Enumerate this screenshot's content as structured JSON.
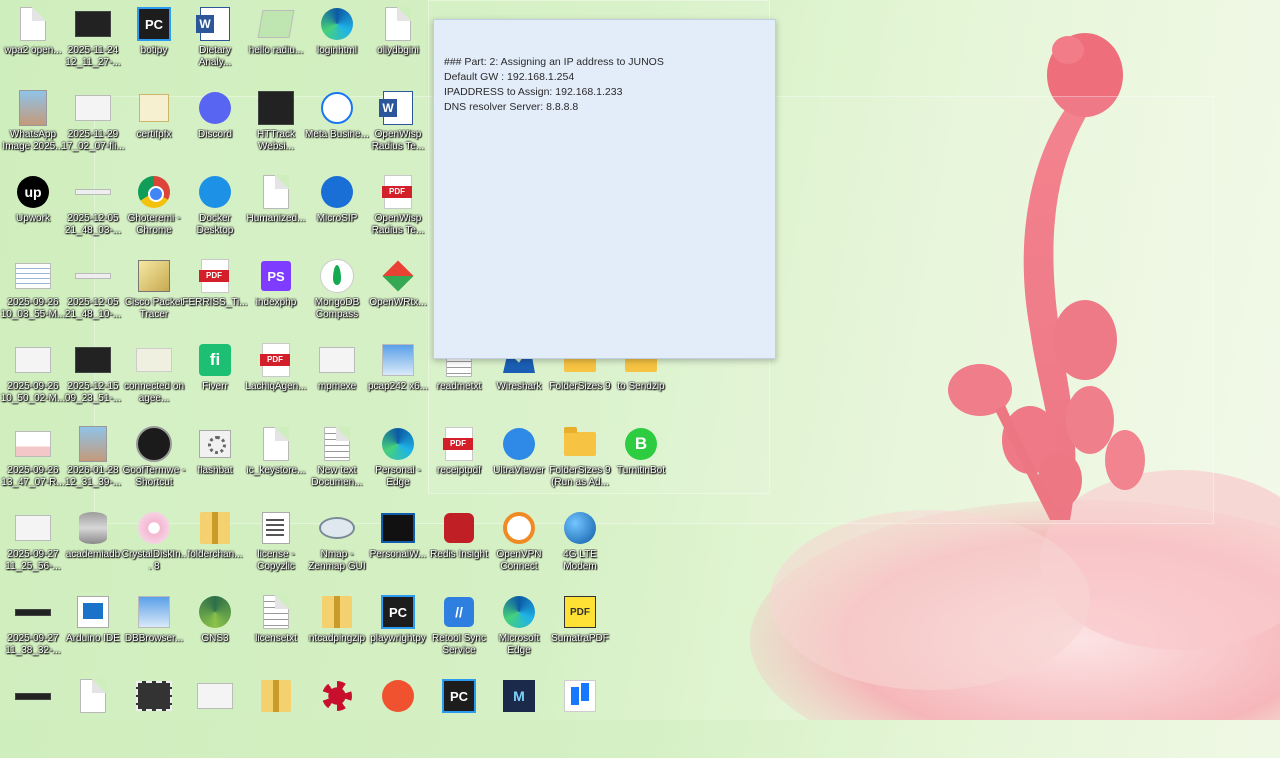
{
  "note": {
    "lines": [
      "### Part: 2: Assigning an IP address to JUNOS",
      "Default GW : 192.168.1.254",
      "IPADDRESS to Assign: 192.168.1.233",
      "DNS resolver Server: 8.8.8.8"
    ]
  },
  "icons": [
    {
      "label": "wpa2 open...",
      "type": "doc"
    },
    {
      "label": "2025-11-24 12_11_27-...",
      "type": "thumb-dark-white"
    },
    {
      "label": "botipy",
      "type": "pc"
    },
    {
      "label": "Dietary Analy...",
      "type": "word"
    },
    {
      "label": "hello radiu...",
      "type": "notepad-green"
    },
    {
      "label": "loginhtml",
      "type": "edge"
    },
    {
      "label": "ollydbgini",
      "type": "doc-gear"
    },
    {
      "label": "WhatsApp Image 2025...",
      "type": "photo"
    },
    {
      "label": "2025-11-29 17_02_07-fli...",
      "type": "thumb"
    },
    {
      "label": "certifpfx",
      "type": "cert"
    },
    {
      "label": "Discord",
      "type": "discord"
    },
    {
      "label": "HTTrack Websi...",
      "type": "httrack"
    },
    {
      "label": "Meta Busine...",
      "type": "meta"
    },
    {
      "label": "OpenWisp Radius Te...",
      "type": "word"
    },
    {
      "label": "Upwork",
      "type": "upwork"
    },
    {
      "label": "2025-12-05 21_48_03-...",
      "type": "thumb-line"
    },
    {
      "label": "Ghoteremi - Chrome",
      "type": "chrome"
    },
    {
      "label": "Docker Desktop",
      "type": "docker"
    },
    {
      "label": "Humanized...",
      "type": "doc"
    },
    {
      "label": "MicroSIP",
      "type": "phone"
    },
    {
      "label": "OpenWisp Radius Te...",
      "type": "pdf"
    },
    {
      "label": "2025-09-26 10_03_55-M...",
      "type": "thumb-lines"
    },
    {
      "label": "2025-12-05 21_48_10-...",
      "type": "thumb-line"
    },
    {
      "label": "Cisco Packet Tracer",
      "type": "cisco"
    },
    {
      "label": "FERRISS_Ti...",
      "type": "pdf"
    },
    {
      "label": "indexphp",
      "type": "ps"
    },
    {
      "label": "MongoDB Compass",
      "type": "mongo"
    },
    {
      "label": "OpenWRtx...",
      "type": "diamond"
    },
    {
      "label": "2025-09-26 10_50_02-M...",
      "type": "thumb"
    },
    {
      "label": "2025-12-15 09_23_51-...",
      "type": "thumb-dark"
    },
    {
      "label": "connected on agee...",
      "type": "connected"
    },
    {
      "label": "Fiverr",
      "type": "fiverr"
    },
    {
      "label": "LachiqAgen...",
      "type": "pdf"
    },
    {
      "label": "mpmexe",
      "type": "thumb"
    },
    {
      "label": "pcap242 x6...",
      "type": "installer"
    },
    {
      "label": "2025-09-26 13_47_07-R...",
      "type": "thumb-pink"
    },
    {
      "label": "2026-01-28 12_31_39-...",
      "type": "photo"
    },
    {
      "label": "GoofTermwe - Shortcut",
      "type": "gooft"
    },
    {
      "label": "flashbat",
      "type": "gear"
    },
    {
      "label": "ic_keystore...",
      "type": "doc"
    },
    {
      "label": "New text Documen...",
      "type": "doc-lines"
    },
    {
      "label": "Personal - Edge",
      "type": "edge"
    },
    {
      "label": "receiptpdf",
      "type": "pdf"
    },
    {
      "label": "UltraViewer",
      "type": "monitor-circle"
    },
    {
      "label": "FolderSizes 9 (Run as Ad...",
      "type": "folder"
    },
    {
      "label": "TurnitinBot",
      "type": "bot"
    },
    {
      "label": "readmetxt",
      "type": "doc-lines"
    },
    {
      "label": "Wireshark",
      "type": "wire"
    },
    {
      "label": "FolderSizes 9",
      "type": "folder"
    },
    {
      "label": "to Sendzip",
      "type": "folder"
    },
    {
      "label": "2025-09-27 11_25_56-...",
      "type": "thumb"
    },
    {
      "label": "academiadb",
      "type": "db"
    },
    {
      "label": "CrystalDiskIn... 8",
      "type": "flower"
    },
    {
      "label": "folderchan...",
      "type": "zip"
    },
    {
      "label": "license - Copyzlic",
      "type": "notepad"
    },
    {
      "label": "Nmap - Zenmap GUI",
      "type": "eye"
    },
    {
      "label": "PersonalW...",
      "type": "cmd"
    },
    {
      "label": "Redis Insight",
      "type": "redis"
    },
    {
      "label": "OpenVPN Connect",
      "type": "openvpn"
    },
    {
      "label": "4G LTE Modem",
      "type": "globe"
    },
    {
      "label": "2025-09-27 11_38_32-...",
      "type": "thumb-dark-line"
    },
    {
      "label": "Arduino IDE",
      "type": "ardu"
    },
    {
      "label": "DBBrowser...",
      "type": "installer"
    },
    {
      "label": "GNS3",
      "type": "gns"
    },
    {
      "label": "licensetxt",
      "type": "doc-lines"
    },
    {
      "label": "ntcadpingzip",
      "type": "zip"
    },
    {
      "label": "playwrightpy",
      "type": "pc"
    },
    {
      "label": "Retool Sync Service",
      "type": "retool"
    },
    {
      "label": "Microsoft Edge",
      "type": "edge"
    },
    {
      "label": "SumatraPDF",
      "type": "sumatra"
    },
    {
      "label": "",
      "type": "thumb-dark-line"
    },
    {
      "label": "",
      "type": "doc"
    },
    {
      "label": "",
      "type": "film"
    },
    {
      "label": "",
      "type": "thumb"
    },
    {
      "label": "",
      "type": "zip"
    },
    {
      "label": "",
      "type": "splat"
    },
    {
      "label": "",
      "type": "orange"
    },
    {
      "label": "",
      "type": "pc"
    },
    {
      "label": "",
      "type": "mvn"
    },
    {
      "label": "",
      "type": "bluebox"
    }
  ]
}
